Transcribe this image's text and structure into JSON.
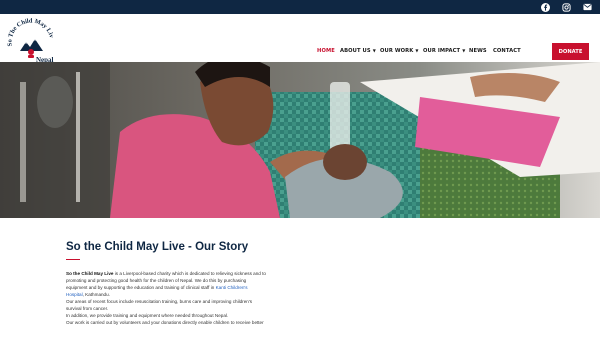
{
  "topbar": {
    "socials": [
      {
        "icon": "facebook-icon",
        "glyph": "f"
      },
      {
        "icon": "instagram-icon",
        "glyph": "◎"
      },
      {
        "icon": "email-icon",
        "glyph": "✉"
      }
    ]
  },
  "logo": {
    "line1": "So The Child May Live",
    "line2": "Nepal"
  },
  "nav": {
    "home": "HOME",
    "about": "ABOUT US",
    "work": "OUR WORK",
    "impact": "OUR IMPACT",
    "news": "NEWS",
    "contact": "CONTACT",
    "donate": "DONATE"
  },
  "story": {
    "title": "So the Child May Live - Our Story",
    "p1_bold": "So the Child May Live",
    "p1_rest": " is a Liverpool-based charity which is dedicated to relieving sickness and to",
    "p1_l2": "promoting and protecting good health for the children of Nepal. We do this by purchasing",
    "p1_l3a": "equipment and by supporting the education and training of clinical staff in ",
    "p1_link1": "Kanti Children's",
    "p1_link2": "Hospital",
    "p1_l4": ", Kathmandu.",
    "p2_l1": "Our areas of recent focus include resuscitation training, burns care and improving children's",
    "p2_l2": "survival from cancer.",
    "p3": "In addition, we provide training and equipment where needed throughout Nepal.",
    "p4": "Our work is carried out by volunteers and your donations directly enable children to receive better"
  },
  "colors": {
    "navy": "#0f2743",
    "red": "#c8102e",
    "link": "#1f5fbf"
  }
}
